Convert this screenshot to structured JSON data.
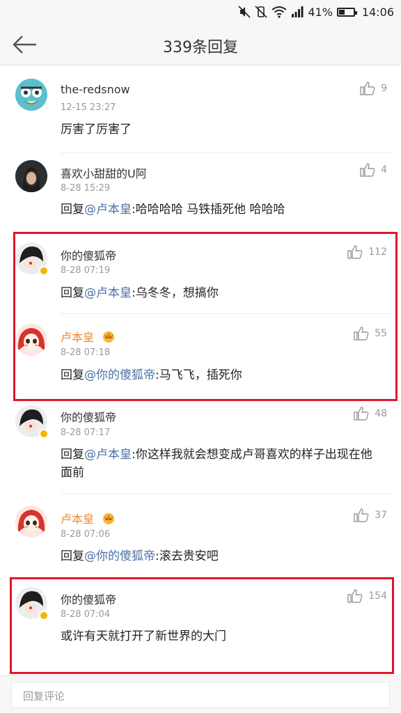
{
  "status_bar": {
    "battery": "41%",
    "time": "14:06",
    "battery_level": 0.41
  },
  "header": {
    "title": "339条回复"
  },
  "comments": [
    {
      "user": "the-redsnow",
      "time": "12-15 23:27",
      "likes": "9",
      "prefix": "",
      "mention": "",
      "text": "厉害了厉害了"
    },
    {
      "user": "喜欢小甜甜的U阿",
      "time": "8-28 15:29",
      "likes": "4",
      "prefix": "回复",
      "mention": "@卢本皇",
      "text": ":哈哈哈哈 马铁插死他 哈哈哈"
    },
    {
      "user": "你的傻狐帝",
      "time": "8-28 07:19",
      "likes": "112",
      "prefix": "回复",
      "mention": "@卢本皇",
      "text": ":乌冬冬，想搞你"
    },
    {
      "user": "卢本皇",
      "time": "8-28 07:18",
      "likes": "55",
      "prefix": "回复",
      "mention": "@你的傻狐帝",
      "text": ":马飞飞，插死你"
    },
    {
      "user": "你的傻狐帝",
      "time": "8-28 07:17",
      "likes": "48",
      "prefix": "回复",
      "mention": "@卢本皇",
      "text": ":你这样我就会想变成卢哥喜欢的样子出现在他面前"
    },
    {
      "user": "卢本皇",
      "time": "8-28 07:06",
      "likes": "37",
      "prefix": "回复",
      "mention": "@你的傻狐帝",
      "text": ":滚去贵安吧"
    },
    {
      "user": "你的傻狐帝",
      "time": "8-28 07:04",
      "likes": "154",
      "prefix": "",
      "mention": "",
      "text": "或许有天就打开了新世界的大门"
    }
  ],
  "reply_bar": {
    "placeholder": "回复评论"
  },
  "colors": {
    "accent_mention": "#4a6fa5",
    "highlight": "#e0162b",
    "orange_name": "#f08a2c"
  }
}
